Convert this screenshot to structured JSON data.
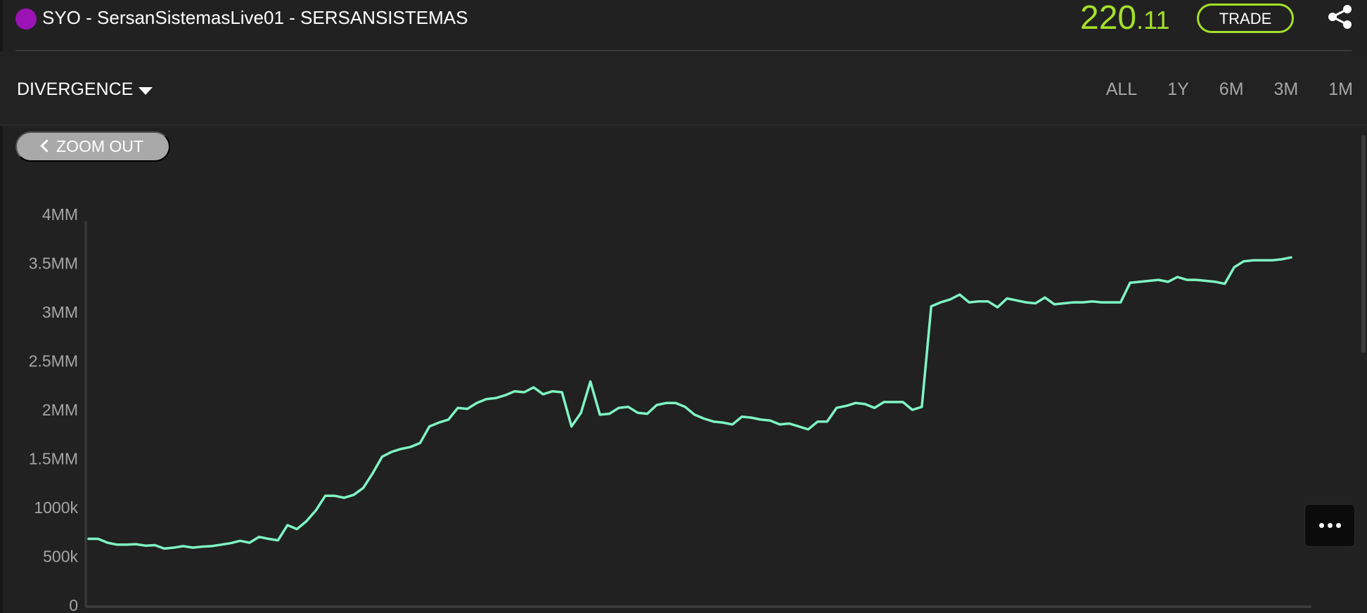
{
  "header": {
    "title": "SYO - SersanSistemasLive01 - SERSANSISTEMAS",
    "dot_color": "#9b13b5",
    "price_main": "220",
    "price_cents": ".11",
    "price_color": "#a4e02a",
    "trade_label": "TRADE",
    "trade_color": "#a4e02a",
    "share_icon": "share-icon"
  },
  "controls": {
    "metric_label": "DIVERGENCE",
    "ranges": [
      "ALL",
      "1Y",
      "6M",
      "3M",
      "1M"
    ]
  },
  "chart_actions": {
    "zoom_out_label": "ZOOM OUT",
    "more_icon": "more-horizontal-icon"
  },
  "chart_data": {
    "type": "line",
    "title": "",
    "xlabel": "",
    "ylabel": "",
    "ylim": [
      0,
      4000000
    ],
    "y_ticks": [
      0,
      500000,
      1000000,
      1500000,
      2000000,
      2500000,
      3000000,
      3500000,
      4000000
    ],
    "y_tick_labels": [
      "0",
      "500k",
      "1000k",
      "1.5MM",
      "2MM",
      "2.5MM",
      "3MM",
      "3.5MM",
      "4MM"
    ],
    "grid": false,
    "line_color": "#7ff5c4",
    "series": [
      {
        "values": [
          680000,
          680000,
          640000,
          620000,
          620000,
          625000,
          610000,
          615000,
          580000,
          590000,
          605000,
          590000,
          600000,
          605000,
          620000,
          635000,
          660000,
          640000,
          700000,
          680000,
          665000,
          820000,
          780000,
          860000,
          970000,
          1120000,
          1120000,
          1100000,
          1130000,
          1200000,
          1350000,
          1520000,
          1570000,
          1600000,
          1620000,
          1660000,
          1830000,
          1870000,
          1900000,
          2020000,
          2010000,
          2070000,
          2110000,
          2120000,
          2150000,
          2190000,
          2180000,
          2230000,
          2160000,
          2190000,
          2180000,
          1830000,
          1970000,
          2290000,
          1950000,
          1960000,
          2020000,
          2030000,
          1970000,
          1960000,
          2050000,
          2070000,
          2070000,
          2030000,
          1950000,
          1910000,
          1880000,
          1870000,
          1850000,
          1930000,
          1920000,
          1900000,
          1890000,
          1850000,
          1860000,
          1830000,
          1800000,
          1880000,
          1880000,
          2020000,
          2040000,
          2070000,
          2060000,
          2020000,
          2080000,
          2080000,
          2080000,
          2000000,
          2030000,
          3060000,
          3100000,
          3130000,
          3180000,
          3100000,
          3110000,
          3110000,
          3050000,
          3140000,
          3120000,
          3100000,
          3090000,
          3150000,
          3080000,
          3090000,
          3100000,
          3100000,
          3110000,
          3100000,
          3100000,
          3100000,
          3300000,
          3310000,
          3320000,
          3330000,
          3310000,
          3360000,
          3330000,
          3330000,
          3320000,
          3310000,
          3290000,
          3460000,
          3520000,
          3530000,
          3530000,
          3530000,
          3540000,
          3560000
        ]
      }
    ]
  }
}
